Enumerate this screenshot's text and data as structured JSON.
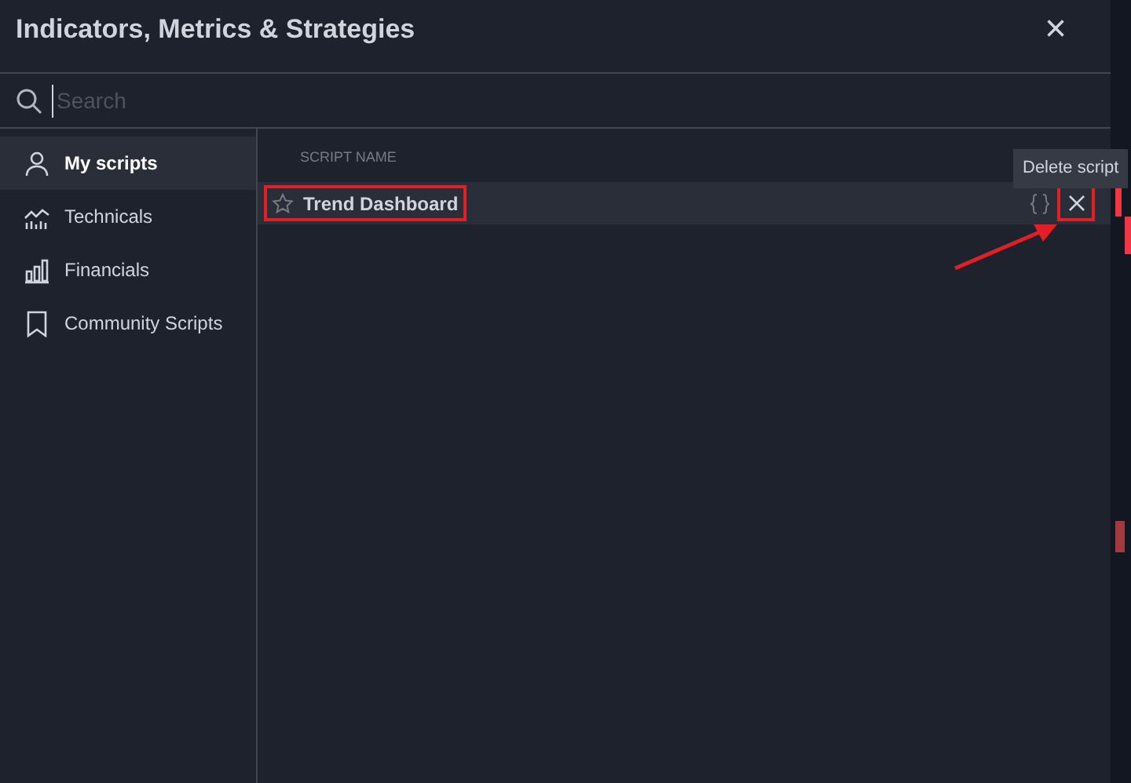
{
  "dialog": {
    "title": "Indicators, Metrics & Strategies",
    "close": "×"
  },
  "search": {
    "placeholder": "Search"
  },
  "sidebar": {
    "items": [
      {
        "label": "My scripts",
        "kind": "user",
        "selected": true
      },
      {
        "label": "Technicals",
        "kind": "technicals",
        "selected": false
      },
      {
        "label": "Financials",
        "kind": "financials",
        "selected": false
      },
      {
        "label": "Community Scripts",
        "kind": "community",
        "selected": false
      }
    ]
  },
  "table": {
    "columns": [
      "SCRIPT NAME"
    ],
    "rows": [
      {
        "name": "Trend Dashboard",
        "favorite": false,
        "hovered": true
      }
    ]
  },
  "tooltip": "Delete script"
}
